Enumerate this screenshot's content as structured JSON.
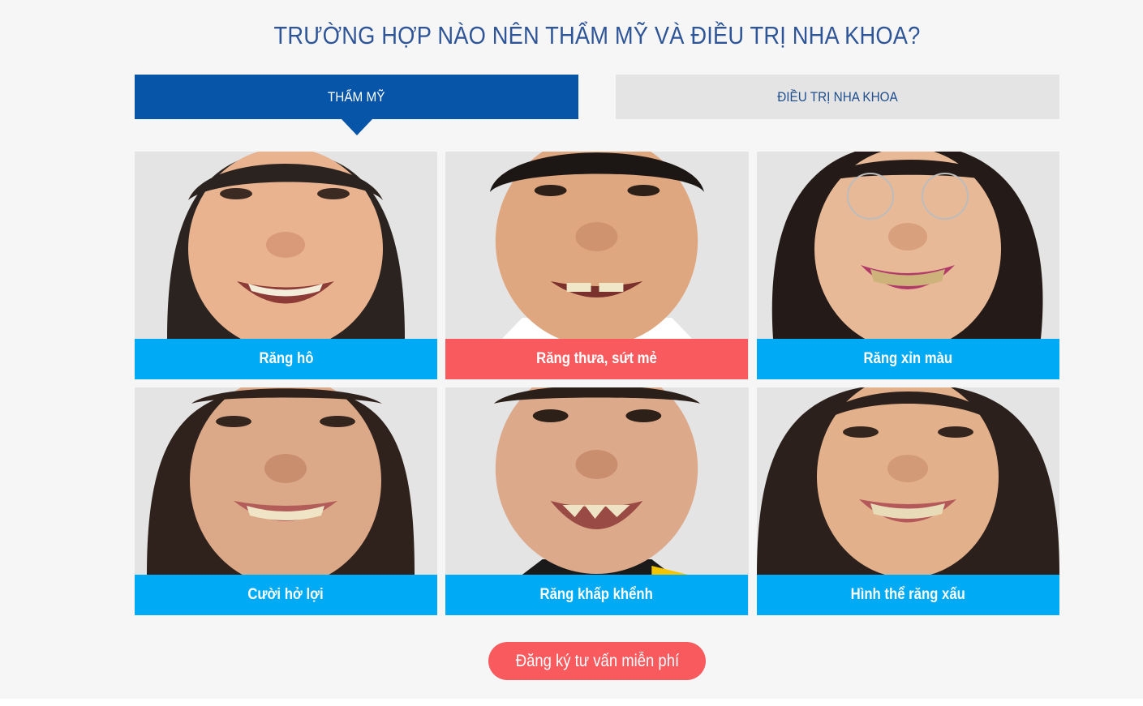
{
  "section": {
    "title": "TRƯỜNG HỢP NÀO NÊN THẨM MỸ VÀ ĐIỀU TRỊ NHA KHOA?",
    "tabs": [
      {
        "label": "THẨM MỸ",
        "active": true
      },
      {
        "label": "ĐIỀU TRỊ NHA KHOA",
        "active": false
      }
    ],
    "cases": [
      {
        "label": "Răng hô",
        "label_color": "#00aaf5"
      },
      {
        "label": "Răng thưa, sứt mẻ",
        "label_color": "#f85a5e"
      },
      {
        "label": "Răng xỉn màu",
        "label_color": "#00aaf5"
      },
      {
        "label": "Cười hở lợi",
        "label_color": "#00aaf5"
      },
      {
        "label": "Răng khấp khểnh",
        "label_color": "#00aaf5"
      },
      {
        "label": "Hình thể răng xấu",
        "label_color": "#00aaf5"
      }
    ],
    "cta_label": "Đăng ký tư vấn miễn phí",
    "colors": {
      "title": "#2e5597",
      "tab_active_bg": "#0755a8",
      "tab_inactive_bg": "#e4e4e4",
      "cta_bg": "#f85a5e"
    }
  }
}
